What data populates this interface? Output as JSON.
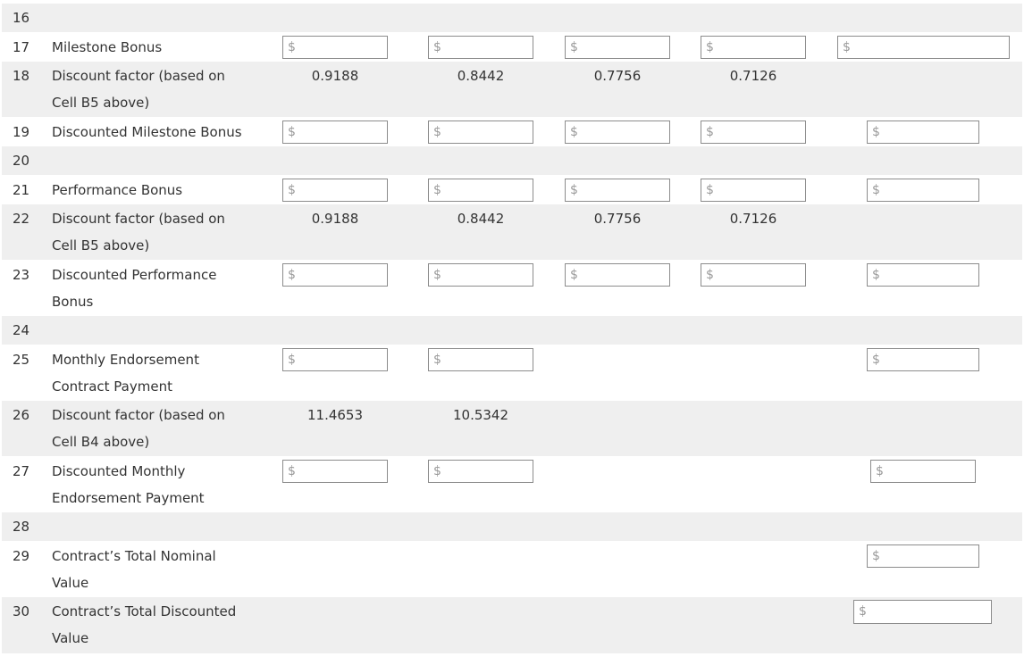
{
  "currency_symbol": "$",
  "rows": {
    "r16": {
      "num": "16"
    },
    "r17": {
      "num": "17",
      "label": "Milestone Bonus"
    },
    "r18": {
      "num": "18",
      "label_line1": "Discount factor (based on",
      "label_line2": "Cell B5 above)",
      "values": [
        "0.9188",
        "0.8442",
        "0.7756",
        "0.7126"
      ]
    },
    "r19": {
      "num": "19",
      "label": "Discounted Milestone Bonus"
    },
    "r20": {
      "num": "20"
    },
    "r21": {
      "num": "21",
      "label": "Performance Bonus"
    },
    "r22": {
      "num": "22",
      "label_line1": "Discount factor (based on",
      "label_line2": "Cell B5 above)",
      "values": [
        "0.9188",
        "0.8442",
        "0.7756",
        "0.7126"
      ]
    },
    "r23": {
      "num": "23",
      "label_line1": "Discounted Performance",
      "label_line2": "Bonus"
    },
    "r24": {
      "num": "24"
    },
    "r25": {
      "num": "25",
      "label_line1": "Monthly Endorsement",
      "label_line2": "Contract Payment"
    },
    "r26": {
      "num": "26",
      "label_line1": "Discount factor (based on",
      "label_line2": "Cell B4 above)",
      "values": [
        "11.4653",
        "10.5342"
      ]
    },
    "r27": {
      "num": "27",
      "label_line1": "Discounted Monthly",
      "label_line2": "Endorsement Payment"
    },
    "r28": {
      "num": "28"
    },
    "r29": {
      "num": "29",
      "label_line1": "Contract’s Total Nominal",
      "label_line2": "Value"
    },
    "r30": {
      "num": "30",
      "label_line1": "Contract’s Total Discounted",
      "label_line2": "Value"
    }
  }
}
